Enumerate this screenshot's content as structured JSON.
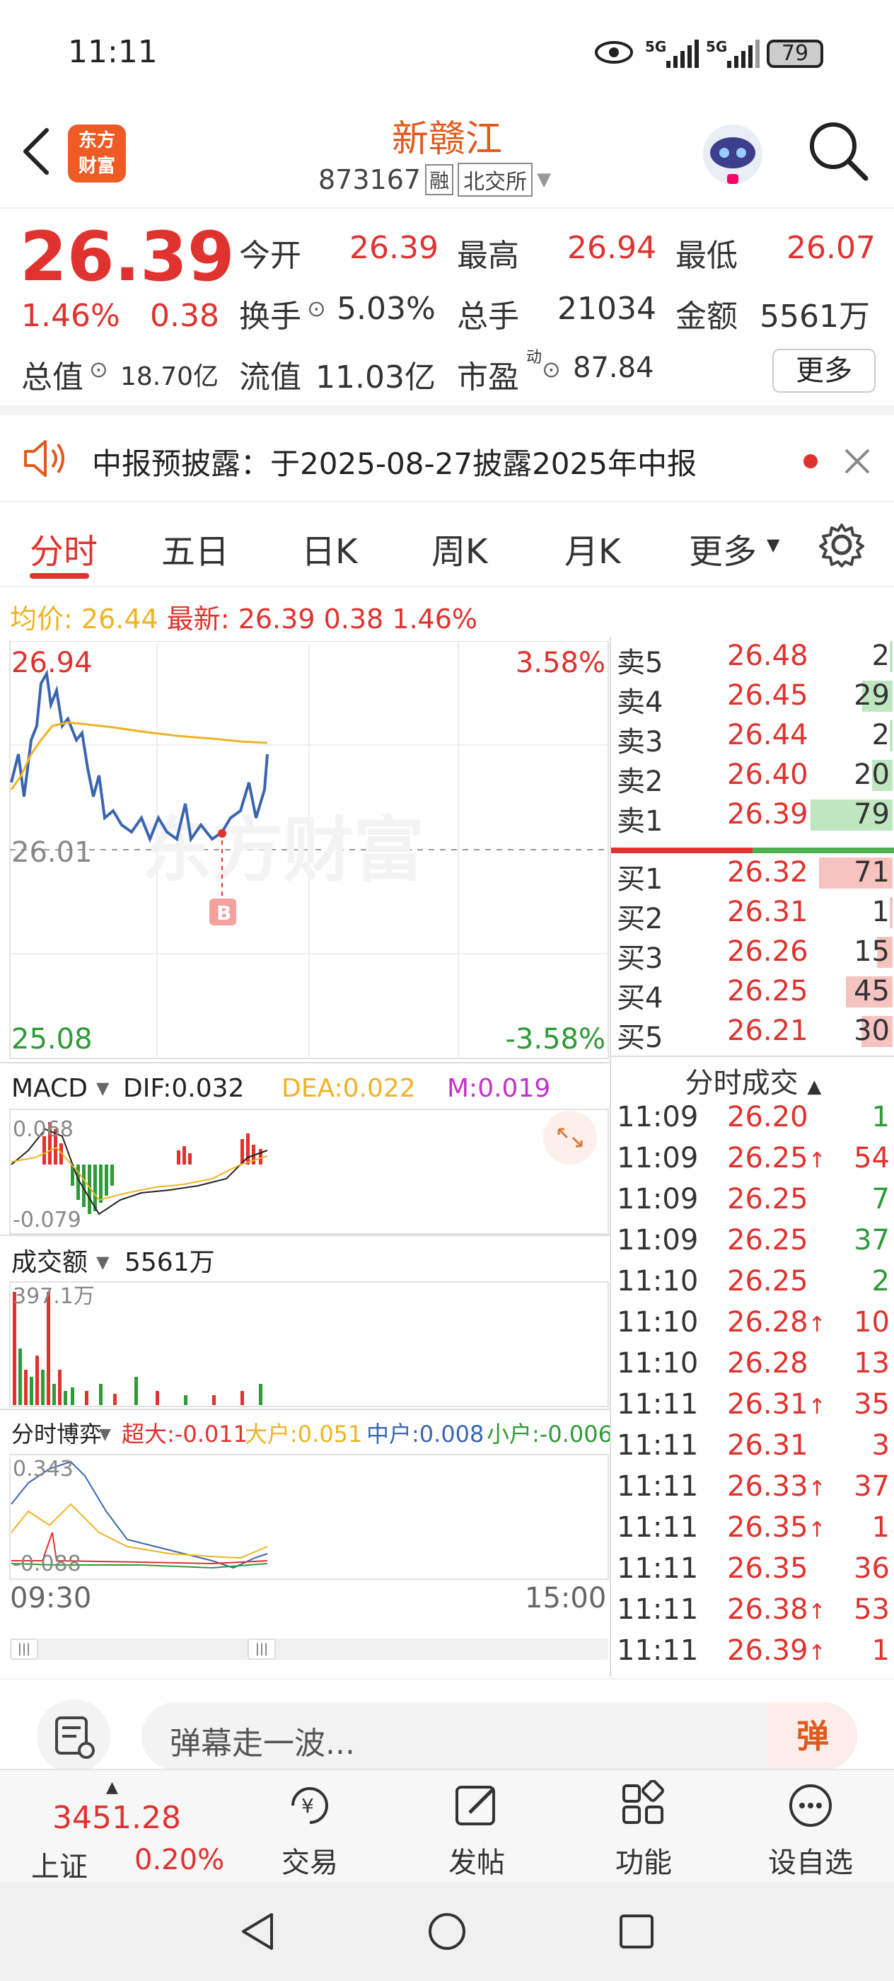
{
  "status_bar": {
    "time": "11:11",
    "signal1": "5G",
    "signal2": "5G",
    "battery": "79"
  },
  "header": {
    "title": "新赣江",
    "code": "873167",
    "badge_margin": "融",
    "badge_exchange": "北交所",
    "logo_line1": "东方",
    "logo_line2": "财富"
  },
  "quote": {
    "price": "26.39",
    "change_pct": "1.46%",
    "change": "0.38",
    "open_label": "今开",
    "open": "26.39",
    "high_label": "最高",
    "high": "26.94",
    "low_label": "最低",
    "low": "26.07",
    "turnover_label": "换手",
    "turnover": "5.03%",
    "volume_label": "总手",
    "volume": "21034",
    "amount_label": "金额",
    "amount": "5561万",
    "mktcap_label": "总值",
    "mktcap": "18.70亿",
    "float_label": "流值",
    "float_cap": "11.03亿",
    "pe_label": "市盈",
    "pe_sup": "动",
    "pe": "87.84",
    "more_button": "更多"
  },
  "notice": {
    "text": "中报预披露：于2025-08-27披露2025年中报"
  },
  "tabs": [
    "分时",
    "五日",
    "日K",
    "周K",
    "月K",
    "更多"
  ],
  "chart_header": {
    "avg_label": "均价:",
    "avg": "26.44",
    "latest_label": "最新:",
    "latest": "26.39",
    "change": "0.38",
    "change_pct": "1.46%"
  },
  "chart": {
    "y_top": "26.94",
    "y_mid": "26.01",
    "y_bottom": "25.08",
    "pct_top": "3.58%",
    "pct_bottom": "-3.58%",
    "watermark": "东方财富",
    "marker": "B",
    "time_start": "09:30",
    "time_end": "15:00"
  },
  "macd": {
    "name": "MACD",
    "dif": "DIF:0.032",
    "dea": "DEA:0.022",
    "m": "M:0.019",
    "y_top": "0.068",
    "y_bottom": "-0.079"
  },
  "volume_panel": {
    "name": "成交额",
    "value": "5561万",
    "y_top": "397.1万"
  },
  "flow_panel": {
    "name": "分时博弈",
    "super": "超大:-0.011",
    "large": "大户:0.051",
    "mid": "中户:0.008",
    "small": "小户:-0.006",
    "y_top": "0.343",
    "y_bottom": "-0.088"
  },
  "orderbook": {
    "asks": [
      {
        "label": "卖5",
        "price": "26.48",
        "vol": "2",
        "w": 0.03
      },
      {
        "label": "卖4",
        "price": "26.45",
        "vol": "29",
        "w": 0.37
      },
      {
        "label": "卖3",
        "price": "26.44",
        "vol": "2",
        "w": 0.03
      },
      {
        "label": "卖2",
        "price": "26.40",
        "vol": "20",
        "w": 0.25
      },
      {
        "label": "卖1",
        "price": "26.39",
        "vol": "79",
        "w": 1.0
      }
    ],
    "bids": [
      {
        "label": "买1",
        "price": "26.32",
        "vol": "71",
        "w": 0.9
      },
      {
        "label": "买2",
        "price": "26.31",
        "vol": "1",
        "w": 0.01
      },
      {
        "label": "买3",
        "price": "26.26",
        "vol": "15",
        "w": 0.19
      },
      {
        "label": "买4",
        "price": "26.25",
        "vol": "45",
        "w": 0.57
      },
      {
        "label": "买5",
        "price": "26.21",
        "vol": "30",
        "w": 0.38
      }
    ],
    "ticks_title": "分时成交",
    "ticks": [
      {
        "t": "11:09",
        "p": "26.20",
        "up": "",
        "v": "1",
        "c": "green"
      },
      {
        "t": "11:09",
        "p": "26.25",
        "up": "↑",
        "v": "54",
        "c": "red"
      },
      {
        "t": "11:09",
        "p": "26.25",
        "up": "",
        "v": "7",
        "c": "green"
      },
      {
        "t": "11:09",
        "p": "26.25",
        "up": "",
        "v": "37",
        "c": "green"
      },
      {
        "t": "11:10",
        "p": "26.25",
        "up": "",
        "v": "2",
        "c": "green"
      },
      {
        "t": "11:10",
        "p": "26.28",
        "up": "↑",
        "v": "10",
        "c": "red"
      },
      {
        "t": "11:10",
        "p": "26.28",
        "up": "",
        "v": "13",
        "c": "red"
      },
      {
        "t": "11:11",
        "p": "26.31",
        "up": "↑",
        "v": "35",
        "c": "red"
      },
      {
        "t": "11:11",
        "p": "26.31",
        "up": "",
        "v": "3",
        "c": "red"
      },
      {
        "t": "11:11",
        "p": "26.33",
        "up": "↑",
        "v": "37",
        "c": "red"
      },
      {
        "t": "11:11",
        "p": "26.35",
        "up": "↑",
        "v": "1",
        "c": "red"
      },
      {
        "t": "11:11",
        "p": "26.35",
        "up": "",
        "v": "36",
        "c": "red"
      },
      {
        "t": "11:11",
        "p": "26.38",
        "up": "↑",
        "v": "53",
        "c": "red"
      },
      {
        "t": "11:11",
        "p": "26.39",
        "up": "↑",
        "v": "1",
        "c": "red"
      }
    ]
  },
  "comment": {
    "placeholder": "弹幕走一波...",
    "danmu_button": "弹"
  },
  "bottom_nav": {
    "index_value": "3451.28",
    "index_name": "上证",
    "index_change": "0.20%",
    "items": [
      "交易",
      "发帖",
      "功能",
      "设自选"
    ]
  },
  "colors": {
    "up": "#e0322e",
    "down": "#2f9a37",
    "price_line": "#3a66b0",
    "avg_line": "#f0b323"
  }
}
